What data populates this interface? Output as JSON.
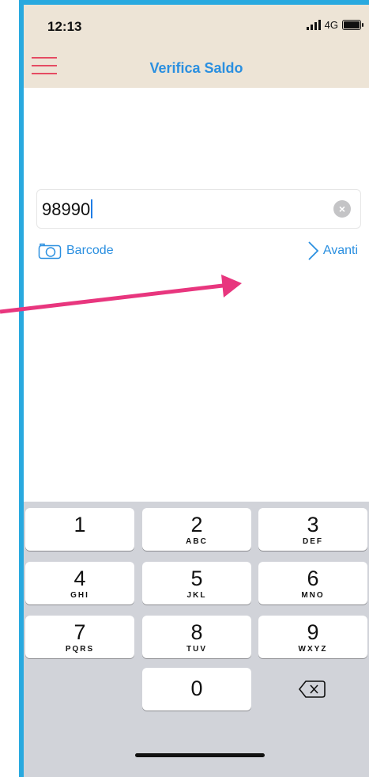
{
  "status_bar": {
    "time": "12:13",
    "network": "4G"
  },
  "nav": {
    "title": "Verifica Saldo",
    "menu_icon": "hamburger-menu-icon"
  },
  "code_input": {
    "value": "98990",
    "clear_icon": "clear-circle-icon"
  },
  "actions": {
    "barcode_label": "Barcode",
    "barcode_icon": "camera-icon",
    "next_label": "Avanti",
    "next_icon": "chevron-right-icon"
  },
  "keypad": {
    "keys": [
      {
        "digit": "1",
        "letters": ""
      },
      {
        "digit": "2",
        "letters": "ABC"
      },
      {
        "digit": "3",
        "letters": "DEF"
      },
      {
        "digit": "4",
        "letters": "GHI"
      },
      {
        "digit": "5",
        "letters": "JKL"
      },
      {
        "digit": "6",
        "letters": "MNO"
      },
      {
        "digit": "7",
        "letters": "PQRS"
      },
      {
        "digit": "8",
        "letters": "TUV"
      },
      {
        "digit": "9",
        "letters": "WXYZ"
      },
      {
        "digit": "0",
        "letters": ""
      }
    ],
    "delete_icon": "backspace-icon"
  },
  "colors": {
    "accent": "#2a8fe0",
    "menu": "#e54b62",
    "header_bg": "#ede4d6",
    "annotation_arrow": "#e8367e",
    "frame": "#29a9df"
  }
}
